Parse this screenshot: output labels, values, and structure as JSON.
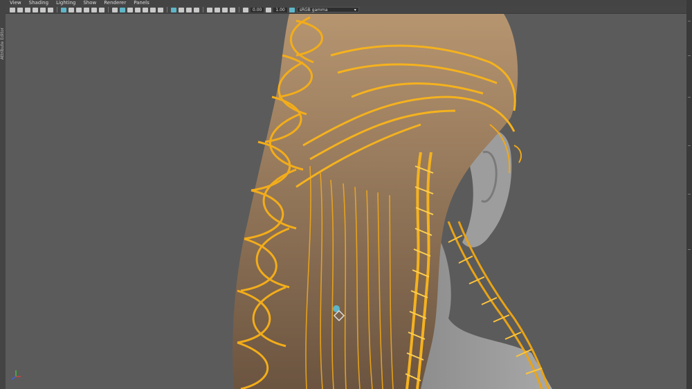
{
  "menu": {
    "items": [
      "View",
      "Shading",
      "Lighting",
      "Show",
      "Renderer",
      "Panels"
    ]
  },
  "toolbar": {
    "exposure_value": "0.00",
    "gamma_value": "1.00",
    "color_space": "sRGB gamma"
  },
  "left_panel": {
    "label": "Attribute Editor"
  },
  "colors": {
    "viewport_bg": "#5b5b5b",
    "hair_highlight": "#f0a818",
    "hair_base": "#8a6a45",
    "skin": "#9a9a9a",
    "accent": "#5fb6c9"
  },
  "icons": {
    "axis_gizmo": "axis-gizmo-icon",
    "manipulator": "move-manipulator-icon",
    "color_space_dropdown": "chevron-down-icon"
  }
}
